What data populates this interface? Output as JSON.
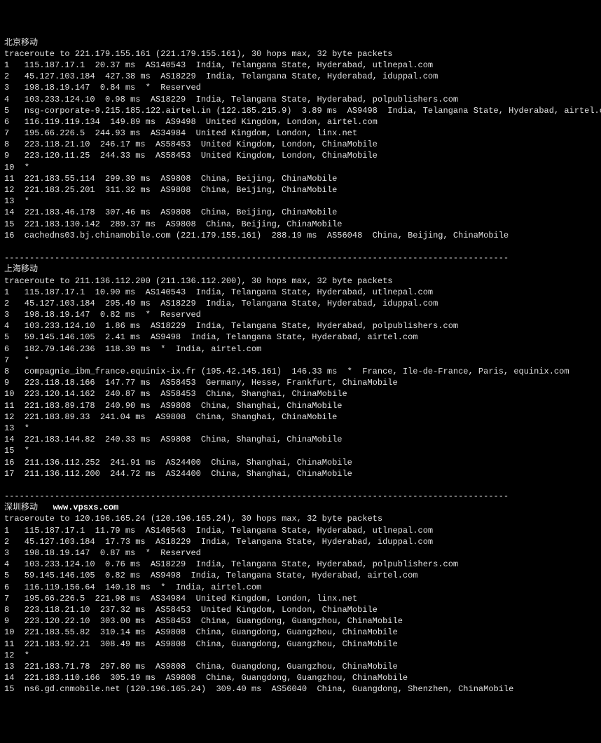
{
  "sections": [
    {
      "title": "北京移动",
      "watermark": "",
      "header": "traceroute to 221.179.155.161 (221.179.155.161), 30 hops max, 32 byte packets",
      "hops": [
        {
          "n": "1",
          "ip": "115.187.17.1",
          "ms": "20.37 ms",
          "asn": "AS140543",
          "loc": "India, Telangana State, Hyderabad, utlnepal.com"
        },
        {
          "n": "2",
          "ip": "45.127.103.184",
          "ms": "427.38 ms",
          "asn": "AS18229",
          "loc": "India, Telangana State, Hyderabad, iduppal.com"
        },
        {
          "n": "3",
          "ip": "198.18.19.147",
          "ms": "0.84 ms",
          "asn": "*",
          "loc": "Reserved"
        },
        {
          "n": "4",
          "ip": "103.233.124.10",
          "ms": "0.98 ms",
          "asn": "AS18229",
          "loc": "India, Telangana State, Hyderabad, polpublishers.com"
        },
        {
          "n": "5",
          "ip": "nsg-corporate-9.215.185.122.airtel.in (122.185.215.9)",
          "ms": "3.89 ms",
          "asn": "AS9498",
          "loc": "India, Telangana State, Hyderabad, airtel.com"
        },
        {
          "n": "6",
          "ip": "116.119.119.134",
          "ms": "149.89 ms",
          "asn": "AS9498",
          "loc": "United Kingdom, London, airtel.com"
        },
        {
          "n": "7",
          "ip": "195.66.226.5",
          "ms": "244.93 ms",
          "asn": "AS34984",
          "loc": "United Kingdom, London, linx.net"
        },
        {
          "n": "8",
          "ip": "223.118.21.10",
          "ms": "246.17 ms",
          "asn": "AS58453",
          "loc": "United Kingdom, London, ChinaMobile"
        },
        {
          "n": "9",
          "ip": "223.120.11.25",
          "ms": "244.33 ms",
          "asn": "AS58453",
          "loc": "United Kingdom, London, ChinaMobile"
        },
        {
          "n": "10",
          "ip": "*",
          "ms": "",
          "asn": "",
          "loc": ""
        },
        {
          "n": "11",
          "ip": "221.183.55.114",
          "ms": "299.39 ms",
          "asn": "AS9808",
          "loc": "China, Beijing, ChinaMobile"
        },
        {
          "n": "12",
          "ip": "221.183.25.201",
          "ms": "311.32 ms",
          "asn": "AS9808",
          "loc": "China, Beijing, ChinaMobile"
        },
        {
          "n": "13",
          "ip": "*",
          "ms": "",
          "asn": "",
          "loc": ""
        },
        {
          "n": "14",
          "ip": "221.183.46.178",
          "ms": "307.46 ms",
          "asn": "AS9808",
          "loc": "China, Beijing, ChinaMobile"
        },
        {
          "n": "15",
          "ip": "221.183.130.142",
          "ms": "289.37 ms",
          "asn": "AS9808",
          "loc": "China, Beijing, ChinaMobile"
        },
        {
          "n": "16",
          "ip": "cachedns03.bj.chinamobile.com (221.179.155.161)",
          "ms": "288.19 ms",
          "asn": "AS56048",
          "loc": "China, Beijing, ChinaMobile"
        }
      ]
    },
    {
      "title": "上海移动",
      "watermark": "",
      "header": "traceroute to 211.136.112.200 (211.136.112.200), 30 hops max, 32 byte packets",
      "hops": [
        {
          "n": "1",
          "ip": "115.187.17.1",
          "ms": "10.90 ms",
          "asn": "AS140543",
          "loc": "India, Telangana State, Hyderabad, utlnepal.com"
        },
        {
          "n": "2",
          "ip": "45.127.103.184",
          "ms": "295.49 ms",
          "asn": "AS18229",
          "loc": "India, Telangana State, Hyderabad, iduppal.com"
        },
        {
          "n": "3",
          "ip": "198.18.19.147",
          "ms": "0.82 ms",
          "asn": "*",
          "loc": "Reserved"
        },
        {
          "n": "4",
          "ip": "103.233.124.10",
          "ms": "1.86 ms",
          "asn": "AS18229",
          "loc": "India, Telangana State, Hyderabad, polpublishers.com"
        },
        {
          "n": "5",
          "ip": "59.145.146.105",
          "ms": "2.41 ms",
          "asn": "AS9498",
          "loc": "India, Telangana State, Hyderabad, airtel.com"
        },
        {
          "n": "6",
          "ip": "182.79.146.236",
          "ms": "118.39 ms",
          "asn": "*",
          "loc": "India, airtel.com"
        },
        {
          "n": "7",
          "ip": "*",
          "ms": "",
          "asn": "",
          "loc": ""
        },
        {
          "n": "8",
          "ip": "compagnie_ibm_france.equinix-ix.fr (195.42.145.161)",
          "ms": "146.33 ms",
          "asn": "*",
          "loc": "France, Ile-de-France, Paris, equinix.com"
        },
        {
          "n": "9",
          "ip": "223.118.18.166",
          "ms": "147.77 ms",
          "asn": "AS58453",
          "loc": "Germany, Hesse, Frankfurt, ChinaMobile"
        },
        {
          "n": "10",
          "ip": "223.120.14.162",
          "ms": "240.87 ms",
          "asn": "AS58453",
          "loc": "China, Shanghai, ChinaMobile"
        },
        {
          "n": "11",
          "ip": "221.183.89.178",
          "ms": "240.90 ms",
          "asn": "AS9808",
          "loc": "China, Shanghai, ChinaMobile"
        },
        {
          "n": "12",
          "ip": "221.183.89.33",
          "ms": "241.04 ms",
          "asn": "AS9808",
          "loc": "China, Shanghai, ChinaMobile"
        },
        {
          "n": "13",
          "ip": "*",
          "ms": "",
          "asn": "",
          "loc": ""
        },
        {
          "n": "14",
          "ip": "221.183.144.82",
          "ms": "240.33 ms",
          "asn": "AS9808",
          "loc": "China, Shanghai, ChinaMobile"
        },
        {
          "n": "15",
          "ip": "*",
          "ms": "",
          "asn": "",
          "loc": ""
        },
        {
          "n": "16",
          "ip": "211.136.112.252",
          "ms": "241.91 ms",
          "asn": "AS24400",
          "loc": "China, Shanghai, ChinaMobile"
        },
        {
          "n": "17",
          "ip": "211.136.112.200",
          "ms": "244.72 ms",
          "asn": "AS24400",
          "loc": "China, Shanghai, ChinaMobile"
        }
      ]
    },
    {
      "title": "深圳移动",
      "watermark": "www.vpsxs.com",
      "header": "traceroute to 120.196.165.24 (120.196.165.24), 30 hops max, 32 byte packets",
      "hops": [
        {
          "n": "1",
          "ip": "115.187.17.1",
          "ms": "11.79 ms",
          "asn": "AS140543",
          "loc": "India, Telangana State, Hyderabad, utlnepal.com"
        },
        {
          "n": "2",
          "ip": "45.127.103.184",
          "ms": "17.73 ms",
          "asn": "AS18229",
          "loc": "India, Telangana State, Hyderabad, iduppal.com"
        },
        {
          "n": "3",
          "ip": "198.18.19.147",
          "ms": "0.87 ms",
          "asn": "*",
          "loc": "Reserved"
        },
        {
          "n": "4",
          "ip": "103.233.124.10",
          "ms": "0.76 ms",
          "asn": "AS18229",
          "loc": "India, Telangana State, Hyderabad, polpublishers.com"
        },
        {
          "n": "5",
          "ip": "59.145.146.105",
          "ms": "0.82 ms",
          "asn": "AS9498",
          "loc": "India, Telangana State, Hyderabad, airtel.com"
        },
        {
          "n": "6",
          "ip": "116.119.156.64",
          "ms": "140.18 ms",
          "asn": "*",
          "loc": "India, airtel.com"
        },
        {
          "n": "7",
          "ip": "195.66.226.5",
          "ms": "221.98 ms",
          "asn": "AS34984",
          "loc": "United Kingdom, London, linx.net"
        },
        {
          "n": "8",
          "ip": "223.118.21.10",
          "ms": "237.32 ms",
          "asn": "AS58453",
          "loc": "United Kingdom, London, ChinaMobile"
        },
        {
          "n": "9",
          "ip": "223.120.22.10",
          "ms": "303.00 ms",
          "asn": "AS58453",
          "loc": "China, Guangdong, Guangzhou, ChinaMobile"
        },
        {
          "n": "10",
          "ip": "221.183.55.82",
          "ms": "310.14 ms",
          "asn": "AS9808",
          "loc": "China, Guangdong, Guangzhou, ChinaMobile"
        },
        {
          "n": "11",
          "ip": "221.183.92.21",
          "ms": "308.49 ms",
          "asn": "AS9808",
          "loc": "China, Guangdong, Guangzhou, ChinaMobile"
        },
        {
          "n": "12",
          "ip": "*",
          "ms": "",
          "asn": "",
          "loc": ""
        },
        {
          "n": "13",
          "ip": "221.183.71.78",
          "ms": "297.80 ms",
          "asn": "AS9808",
          "loc": "China, Guangdong, Guangzhou, ChinaMobile"
        },
        {
          "n": "14",
          "ip": "221.183.110.166",
          "ms": "305.19 ms",
          "asn": "AS9808",
          "loc": "China, Guangdong, Guangzhou, ChinaMobile"
        },
        {
          "n": "15",
          "ip": "ns6.gd.cnmobile.net (120.196.165.24)",
          "ms": "309.40 ms",
          "asn": "AS56040",
          "loc": "China, Guangdong, Shenzhen, ChinaMobile"
        }
      ]
    }
  ],
  "separator": "----------------------------------------------------------------------------------------------------"
}
